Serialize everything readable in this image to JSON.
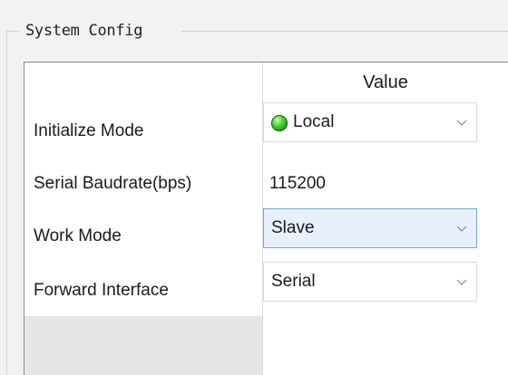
{
  "group": {
    "title": "System Config"
  },
  "grid": {
    "value_header": "Value",
    "rows": [
      {
        "label": "Initialize Mode",
        "value": "Local",
        "status_icon": "green-led-icon",
        "control": "dropdown"
      },
      {
        "label": "Serial Baudrate(bps)",
        "value": "115200",
        "control": "text"
      },
      {
        "label": "Work Mode",
        "value": "Slave",
        "control": "dropdown"
      },
      {
        "label": "Forward Interface",
        "value": "Serial",
        "control": "dropdown"
      }
    ]
  },
  "colors": {
    "focus_border": "#6fa8dc",
    "focus_fill": "#e8f1fb",
    "led_green": "#2fb52a"
  }
}
